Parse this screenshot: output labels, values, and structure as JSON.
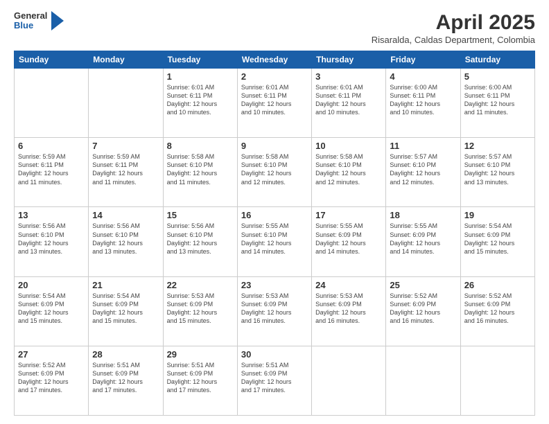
{
  "header": {
    "logo_general": "General",
    "logo_blue": "Blue",
    "title": "April 2025",
    "location": "Risaralda, Caldas Department, Colombia"
  },
  "calendar": {
    "columns": [
      "Sunday",
      "Monday",
      "Tuesday",
      "Wednesday",
      "Thursday",
      "Friday",
      "Saturday"
    ],
    "weeks": [
      [
        {
          "day": "",
          "info": ""
        },
        {
          "day": "",
          "info": ""
        },
        {
          "day": "1",
          "info": "Sunrise: 6:01 AM\nSunset: 6:11 PM\nDaylight: 12 hours\nand 10 minutes."
        },
        {
          "day": "2",
          "info": "Sunrise: 6:01 AM\nSunset: 6:11 PM\nDaylight: 12 hours\nand 10 minutes."
        },
        {
          "day": "3",
          "info": "Sunrise: 6:01 AM\nSunset: 6:11 PM\nDaylight: 12 hours\nand 10 minutes."
        },
        {
          "day": "4",
          "info": "Sunrise: 6:00 AM\nSunset: 6:11 PM\nDaylight: 12 hours\nand 10 minutes."
        },
        {
          "day": "5",
          "info": "Sunrise: 6:00 AM\nSunset: 6:11 PM\nDaylight: 12 hours\nand 11 minutes."
        }
      ],
      [
        {
          "day": "6",
          "info": "Sunrise: 5:59 AM\nSunset: 6:11 PM\nDaylight: 12 hours\nand 11 minutes."
        },
        {
          "day": "7",
          "info": "Sunrise: 5:59 AM\nSunset: 6:11 PM\nDaylight: 12 hours\nand 11 minutes."
        },
        {
          "day": "8",
          "info": "Sunrise: 5:58 AM\nSunset: 6:10 PM\nDaylight: 12 hours\nand 11 minutes."
        },
        {
          "day": "9",
          "info": "Sunrise: 5:58 AM\nSunset: 6:10 PM\nDaylight: 12 hours\nand 12 minutes."
        },
        {
          "day": "10",
          "info": "Sunrise: 5:58 AM\nSunset: 6:10 PM\nDaylight: 12 hours\nand 12 minutes."
        },
        {
          "day": "11",
          "info": "Sunrise: 5:57 AM\nSunset: 6:10 PM\nDaylight: 12 hours\nand 12 minutes."
        },
        {
          "day": "12",
          "info": "Sunrise: 5:57 AM\nSunset: 6:10 PM\nDaylight: 12 hours\nand 13 minutes."
        }
      ],
      [
        {
          "day": "13",
          "info": "Sunrise: 5:56 AM\nSunset: 6:10 PM\nDaylight: 12 hours\nand 13 minutes."
        },
        {
          "day": "14",
          "info": "Sunrise: 5:56 AM\nSunset: 6:10 PM\nDaylight: 12 hours\nand 13 minutes."
        },
        {
          "day": "15",
          "info": "Sunrise: 5:56 AM\nSunset: 6:10 PM\nDaylight: 12 hours\nand 13 minutes."
        },
        {
          "day": "16",
          "info": "Sunrise: 5:55 AM\nSunset: 6:10 PM\nDaylight: 12 hours\nand 14 minutes."
        },
        {
          "day": "17",
          "info": "Sunrise: 5:55 AM\nSunset: 6:09 PM\nDaylight: 12 hours\nand 14 minutes."
        },
        {
          "day": "18",
          "info": "Sunrise: 5:55 AM\nSunset: 6:09 PM\nDaylight: 12 hours\nand 14 minutes."
        },
        {
          "day": "19",
          "info": "Sunrise: 5:54 AM\nSunset: 6:09 PM\nDaylight: 12 hours\nand 15 minutes."
        }
      ],
      [
        {
          "day": "20",
          "info": "Sunrise: 5:54 AM\nSunset: 6:09 PM\nDaylight: 12 hours\nand 15 minutes."
        },
        {
          "day": "21",
          "info": "Sunrise: 5:54 AM\nSunset: 6:09 PM\nDaylight: 12 hours\nand 15 minutes."
        },
        {
          "day": "22",
          "info": "Sunrise: 5:53 AM\nSunset: 6:09 PM\nDaylight: 12 hours\nand 15 minutes."
        },
        {
          "day": "23",
          "info": "Sunrise: 5:53 AM\nSunset: 6:09 PM\nDaylight: 12 hours\nand 16 minutes."
        },
        {
          "day": "24",
          "info": "Sunrise: 5:53 AM\nSunset: 6:09 PM\nDaylight: 12 hours\nand 16 minutes."
        },
        {
          "day": "25",
          "info": "Sunrise: 5:52 AM\nSunset: 6:09 PM\nDaylight: 12 hours\nand 16 minutes."
        },
        {
          "day": "26",
          "info": "Sunrise: 5:52 AM\nSunset: 6:09 PM\nDaylight: 12 hours\nand 16 minutes."
        }
      ],
      [
        {
          "day": "27",
          "info": "Sunrise: 5:52 AM\nSunset: 6:09 PM\nDaylight: 12 hours\nand 17 minutes."
        },
        {
          "day": "28",
          "info": "Sunrise: 5:51 AM\nSunset: 6:09 PM\nDaylight: 12 hours\nand 17 minutes."
        },
        {
          "day": "29",
          "info": "Sunrise: 5:51 AM\nSunset: 6:09 PM\nDaylight: 12 hours\nand 17 minutes."
        },
        {
          "day": "30",
          "info": "Sunrise: 5:51 AM\nSunset: 6:09 PM\nDaylight: 12 hours\nand 17 minutes."
        },
        {
          "day": "",
          "info": ""
        },
        {
          "day": "",
          "info": ""
        },
        {
          "day": "",
          "info": ""
        }
      ]
    ]
  }
}
